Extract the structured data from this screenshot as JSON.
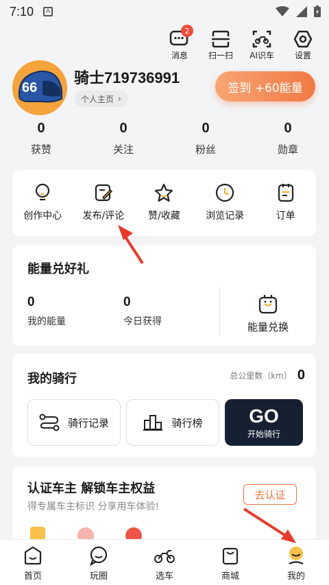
{
  "status": {
    "time": "7:10",
    "notification_icon": "A"
  },
  "top_actions": {
    "messages": {
      "label": "消息",
      "badge": "2"
    },
    "scan": {
      "label": "扫一扫"
    },
    "ai_car": {
      "label": "AI识车"
    },
    "settings": {
      "label": "设置"
    }
  },
  "profile": {
    "username": "骑士719736991",
    "homepage_label": "个人主页",
    "signin_label": "签到 +60能量",
    "avatar_text": "66"
  },
  "stats": [
    {
      "value": "0",
      "label": "获赞"
    },
    {
      "value": "0",
      "label": "关注"
    },
    {
      "value": "0",
      "label": "粉丝"
    },
    {
      "value": "0",
      "label": "勋章"
    }
  ],
  "shortcuts": [
    {
      "label": "创作中心"
    },
    {
      "label": "发布/评论"
    },
    {
      "label": "赞/收藏"
    },
    {
      "label": "浏览记录"
    },
    {
      "label": "订单"
    }
  ],
  "energy": {
    "title": "能量兑好礼",
    "my_energy": {
      "value": "0",
      "label": "我的能量"
    },
    "today": {
      "value": "0",
      "label": "今日获得"
    },
    "exchange_label": "能量兑换"
  },
  "riding": {
    "title": "我的骑行",
    "mileage_label": "总公里数（km）",
    "mileage_value": "0",
    "record_label": "骑行记录",
    "rank_label": "骑行榜",
    "go_label": "GO",
    "go_sub": "开始骑行"
  },
  "cert": {
    "title": "认证车主 解锁车主权益",
    "subtitle": "得专属车主标识 分享用车体验!",
    "button": "去认证"
  },
  "tabs": [
    {
      "label": "首页"
    },
    {
      "label": "玩圈"
    },
    {
      "label": "选车"
    },
    {
      "label": "商城"
    },
    {
      "label": "我的"
    }
  ],
  "colors": {
    "accent": "#f0733f",
    "arrow": "#e8392d",
    "go_bg": "#152033"
  }
}
